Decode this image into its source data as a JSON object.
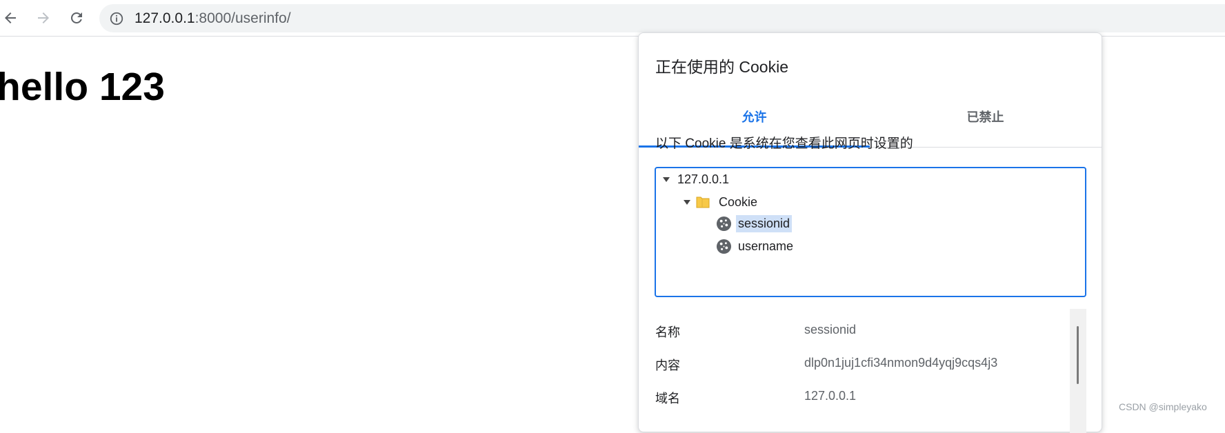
{
  "browser": {
    "url_host": "127.0.0.1",
    "url_rest": ":8000/userinfo/",
    "icons": {
      "back": "back-arrow-icon",
      "forward": "forward-arrow-icon",
      "reload": "reload-icon",
      "info": "info-icon"
    }
  },
  "page": {
    "heading": "hello 123"
  },
  "cookie_dialog": {
    "title": "正在使用的 Cookie",
    "tabs": [
      {
        "label": "允许",
        "active": true
      },
      {
        "label": "已禁止",
        "active": false
      }
    ],
    "description": "以下 Cookie 是系统在您查看此网页时设置的",
    "tree": {
      "host": "127.0.0.1",
      "folder": "Cookie",
      "cookies": [
        "sessionid",
        "username"
      ],
      "selected": "sessionid"
    },
    "details": [
      {
        "key": "名称",
        "value": "sessionid"
      },
      {
        "key": "内容",
        "value": "dlp0n1juj1cfi34nmon9d4yqj9cqs4j3"
      },
      {
        "key": "域名",
        "value": "127.0.0.1"
      }
    ]
  },
  "watermark": "CSDN @simpleyako",
  "colors": {
    "accent": "#1a73e8",
    "selection": "#cfe0f7",
    "omnibox": "#f1f3f4"
  }
}
